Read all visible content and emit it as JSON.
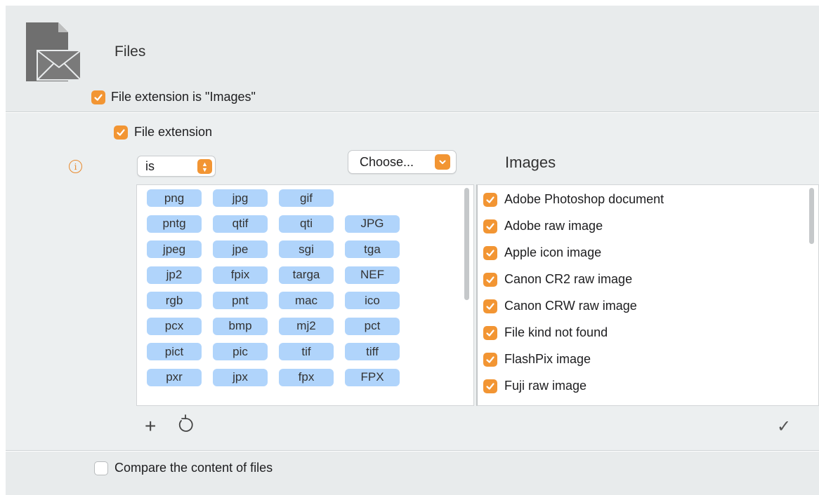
{
  "header": {
    "icon": "file-mail-icon",
    "title": "Files",
    "criterion_label": "File extension is \"Images\"",
    "criterion_checked": true
  },
  "condition": {
    "label": "File extension",
    "checked": true,
    "info_icon": "info-icon",
    "operator": "is",
    "choose_label": "Choose...",
    "selection_title": "Images"
  },
  "extensions": [
    [
      "png",
      "jpg",
      "gif"
    ],
    [
      "pntg",
      "qtif",
      "qti",
      "JPG"
    ],
    [
      "jpeg",
      "jpe",
      "sgi",
      "tga"
    ],
    [
      "jp2",
      "fpix",
      "targa",
      "NEF"
    ],
    [
      "rgb",
      "pnt",
      "mac",
      "ico"
    ],
    [
      "pcx",
      "bmp",
      "mj2",
      "pct"
    ],
    [
      "pict",
      "pic",
      "tif",
      "tiff"
    ],
    [
      "pxr",
      "jpx",
      "fpx",
      "FPX"
    ]
  ],
  "kinds": [
    {
      "label": "Adobe Photoshop document",
      "checked": true
    },
    {
      "label": "Adobe raw image",
      "checked": true
    },
    {
      "label": "Apple icon image",
      "checked": true
    },
    {
      "label": "Canon CR2 raw image",
      "checked": true
    },
    {
      "label": "Canon CRW raw image",
      "checked": true
    },
    {
      "label": "File kind not found",
      "checked": true
    },
    {
      "label": "FlashPix image",
      "checked": true
    },
    {
      "label": "Fuji raw image",
      "checked": true
    }
  ],
  "toolbar": {
    "add_icon": "plus-icon",
    "add_glyph": "+",
    "reset_icon": "reset-icon",
    "confirm_icon": "checkmark-icon",
    "confirm_glyph": "✓"
  },
  "footer": {
    "compare_label": "Compare the content of files",
    "compare_checked": false
  },
  "colors": {
    "accent": "#f29533",
    "tag": "#b0d4fb",
    "panel": "#e8ebec"
  }
}
